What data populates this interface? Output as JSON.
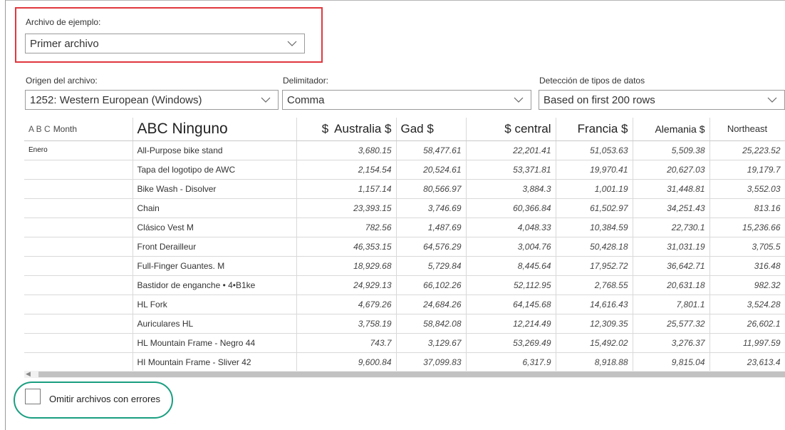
{
  "sample_file": {
    "label": "Archivo de ejemplo:",
    "value": "Primer archivo"
  },
  "file_origin": {
    "label": "Origen del archivo:",
    "value": "1252: Western European (Windows)"
  },
  "delimiter": {
    "label": "Delimitador:",
    "value": "Comma"
  },
  "data_type_detection": {
    "label": "Detección de tipos de datos",
    "value": "Based on first 200 rows"
  },
  "table": {
    "columns": [
      {
        "icon": "A B C",
        "label": "Month"
      },
      {
        "label": "ABC Ninguno"
      },
      {
        "icon": "$",
        "label": "Australia $"
      },
      {
        "label": "Gad $"
      },
      {
        "label": "$ central"
      },
      {
        "label": "Francia $"
      },
      {
        "label": "Alemania $"
      },
      {
        "label": "Northeast"
      }
    ],
    "rows": [
      [
        "Enero",
        "All-Purpose bike stand",
        "3,680.15",
        "58,477.61",
        "22,201.41",
        "51,053.63",
        "5,509.38",
        "25,223.52"
      ],
      [
        "",
        "Tapa del logotipo de AWC",
        "2,154.54",
        "20,524.61",
        "53,371.81",
        "19,970.41",
        "20,627.03",
        "19,179.7"
      ],
      [
        "",
        "Bike Wash - Disolver",
        "1,157.14",
        "80,566.97",
        "3,884.3",
        "1,001.19",
        "31,448.81",
        "3,552.03"
      ],
      [
        "",
        "Chain",
        "23,393.15",
        "3,746.69",
        "60,366.84",
        "61,502.97",
        "34,251.43",
        "813.16"
      ],
      [
        "",
        "Clásico Vest M",
        "782.56",
        "1,487.69",
        "4,048.33",
        "10,384.59",
        "22,730.1",
        "15,236.66"
      ],
      [
        "",
        "Front Derailleur",
        "46,353.15",
        "64,576.29",
        "3,004.76",
        "50,428.18",
        "31,031.19",
        "3,705.5"
      ],
      [
        "",
        "Full-Finger Guantes. M",
        "18,929.68",
        "5,729.84",
        "8,445.64",
        "17,952.72",
        "36,642.71",
        "316.48"
      ],
      [
        "",
        "Bastidor de enganche • 4•B1ke",
        "24,929.13",
        "66,102.26",
        "52,112.95",
        "2,768.55",
        "20,631.18",
        "982.32"
      ],
      [
        "",
        "HL Fork",
        "4,679.26",
        "24,684.26",
        "64,145.68",
        "14,616.43",
        "7,801.1",
        "3,524.28"
      ],
      [
        "",
        "Auriculares HL",
        "3,758.19",
        "58,842.08",
        "12,214.49",
        "12,309.35",
        "25,577.32",
        "26,602.1"
      ],
      [
        "",
        "HL Mountain Frame - Negro 44",
        "743.7",
        "3,129.67",
        "53,269.49",
        "15,492.02",
        "3,276.37",
        "11,997.59"
      ],
      [
        "",
        "HI Mountain Frame - Sliver 42",
        "9,600.84",
        "37,099.83",
        "6,317.9",
        "8,918.88",
        "9,815.04",
        "23,613.4"
      ]
    ]
  },
  "skip_errors": {
    "label": "Omitir archivos con errores",
    "checked": false
  },
  "colors": {
    "highlight_red": "#e0383e",
    "highlight_green": "#1a9e80"
  }
}
